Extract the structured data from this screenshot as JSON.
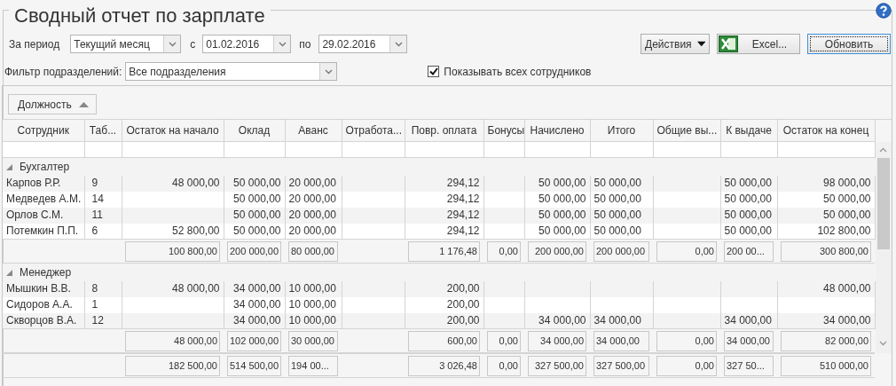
{
  "title": "Сводный отчет по зарплате",
  "period": {
    "label": "За период",
    "value": "Текущий месяц",
    "from_label": "с",
    "from": "01.02.2016",
    "to_label": "по",
    "to": "29.02.2016"
  },
  "buttons": [
    {
      "label": "Действия",
      "kind": "menu",
      "focused": false
    },
    {
      "label": "Excel...",
      "kind": "excel",
      "focused": false
    },
    {
      "label": "Обновить",
      "kind": "plain",
      "focused": true
    }
  ],
  "filter": {
    "label": "Фильтр подразделений:",
    "value": "Все подразделения"
  },
  "show_all": {
    "label": "Показывать всех сотрудников",
    "checked": true
  },
  "group_by": {
    "label": "Должность",
    "ascending": true
  },
  "columns": [
    "Сотрудник",
    "Таб...",
    "Остаток на начало",
    "Оклад",
    "Аванс",
    "Отработа...",
    "Повр. оплата",
    "Бонусы",
    "Начислено",
    "Итого",
    "Общие вы...",
    "К выдаче",
    "Остаток на конец"
  ],
  "groups": [
    {
      "name": "Бухгалтер",
      "expanded": true,
      "rows": [
        {
          "employee": "Карпов Р.Р.",
          "tab_no": "9",
          "opening_balance": "48 000,00",
          "salary": "50 000,00",
          "advance": "20 000,00",
          "time_pay": "294,12",
          "accrued": "50 000,00",
          "total": "50 000,00",
          "payout": "50 000,00",
          "closing_balance": "98 000,00"
        },
        {
          "employee": "Медведев А.М.",
          "tab_no": "14",
          "salary": "50 000,00",
          "advance": "20 000,00",
          "time_pay": "294,12",
          "accrued": "50 000,00",
          "total": "50 000,00",
          "payout": "50 000,00",
          "closing_balance": "50 000,00"
        },
        {
          "employee": "Орлов С.М.",
          "tab_no": "11",
          "salary": "50 000,00",
          "advance": "20 000,00",
          "time_pay": "294,12",
          "accrued": "50 000,00",
          "total": "50 000,00",
          "payout": "50 000,00",
          "closing_balance": "50 000,00"
        },
        {
          "employee": "Потемкин П.П.",
          "tab_no": "6",
          "opening_balance": "52 800,00",
          "salary": "50 000,00",
          "advance": "20 000,00",
          "time_pay": "294,12",
          "accrued": "50 000,00",
          "total": "50 000,00",
          "payout": "50 000,00",
          "closing_balance": "102 800,00"
        }
      ],
      "totals": {
        "opening_balance": "100 800,00",
        "salary": "200 000,00",
        "advance": "80 000,00",
        "time_pay": "1 176,48",
        "bonuses": "0,00",
        "accrued": "200 000,00",
        "total": "200 000,00",
        "deductions": "0,00",
        "payout": "200 00...",
        "closing_balance": "300 800,00"
      }
    },
    {
      "name": "Менеджер",
      "expanded": true,
      "rows": [
        {
          "employee": "Мышкин В.В.",
          "tab_no": "8",
          "opening_balance": "48 000,00",
          "salary": "34 000,00",
          "advance": "10 000,00",
          "time_pay": "200,00",
          "closing_balance": "48 000,00"
        },
        {
          "employee": "Сидоров А.А.",
          "tab_no": "1",
          "salary": "34 000,00",
          "advance": "10 000,00",
          "time_pay": "200,00"
        },
        {
          "employee": "Скворцов В.А.",
          "tab_no": "12",
          "salary": "34 000,00",
          "advance": "10 000,00",
          "time_pay": "200,00",
          "accrued": "34 000,00",
          "total": "34 000,00",
          "payout": "34 000,00",
          "closing_balance": "34 000,00"
        }
      ],
      "totals": {
        "opening_balance": "48 000,00",
        "salary": "102 000,00",
        "advance": "30 000,00",
        "time_pay": "600,00",
        "bonuses": "0,00",
        "accrued": "34 000,00",
        "total": "34 000,00",
        "deductions": "0,00",
        "payout": "34 000,00",
        "closing_balance": "82 000,00"
      }
    }
  ],
  "grand_totals": {
    "opening_balance": "182 500,00",
    "salary": "514 500,00",
    "advance": "194 00...",
    "time_pay": "3 026,48",
    "bonuses": "0,00",
    "accrued": "327 500,00",
    "total": "327 500,00",
    "deductions": "0,00",
    "payout": "327 50...",
    "closing_balance": "510 000,00"
  }
}
